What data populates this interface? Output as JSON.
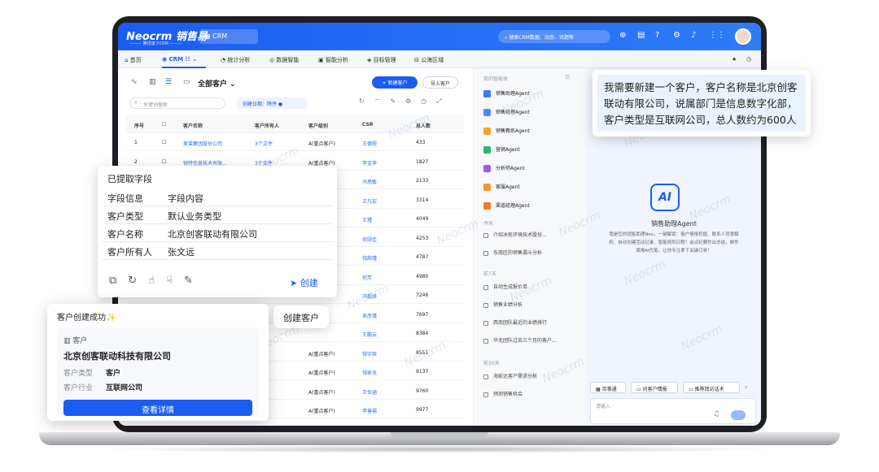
{
  "topbar": {
    "logo": "Neocrm 销售易",
    "logo_sub": "——— 腾讯旗下CRM ———",
    "app_selector": "CRM",
    "search_placeholder": "搜索CRM数据、动态、讯题等"
  },
  "nav": {
    "items": [
      {
        "label": "首页"
      },
      {
        "label": "CRM"
      },
      {
        "label": "统计分析"
      },
      {
        "label": "数据智能"
      },
      {
        "label": "智能分析"
      },
      {
        "label": "目标管理"
      },
      {
        "label": "公海区域"
      }
    ]
  },
  "list": {
    "view_label": "全部客户",
    "new_button": "+ 新建客户",
    "import_button": "导入客户",
    "search_placeholder": "关键词搜索",
    "sort_chip": "创建日期：降序",
    "headers": [
      "序号",
      "客户名称",
      "客户所有人",
      "客户级别",
      "CSR",
      "总人数"
    ],
    "rows": [
      {
        "n": "1",
        "name": "美莱集团股份公司",
        "owner": "3个文件",
        "level": "A(重点客户)",
        "csr": "王德程",
        "total": "433"
      },
      {
        "n": "2",
        "name": "锐特信息技术有限...",
        "owner": "3个文件",
        "level": "A(重点客户)",
        "csr": "李金萍",
        "total": "1827"
      },
      {
        "n": "",
        "name": "",
        "owner": "",
        "level": "",
        "csr": "冯思敏",
        "total": "2133"
      },
      {
        "n": "",
        "name": "",
        "owner": "",
        "level": "",
        "csr": "王凡宏",
        "total": "3314"
      },
      {
        "n": "",
        "name": "",
        "owner": "",
        "level": "",
        "csr": "王瑾",
        "total": "4049"
      },
      {
        "n": "",
        "name": "",
        "owner": "",
        "level": "",
        "csr": "何翊佳",
        "total": "4253"
      },
      {
        "n": "",
        "name": "",
        "owner": "",
        "level": "",
        "csr": "钱韵瑾",
        "total": "4787"
      },
      {
        "n": "",
        "name": "",
        "owner": "",
        "level": "",
        "csr": "何芳",
        "total": "4980"
      },
      {
        "n": "",
        "name": "",
        "owner": "",
        "level": "",
        "csr": "冯毅妍",
        "total": "7246"
      },
      {
        "n": "",
        "name": "",
        "owner": "",
        "level": "",
        "csr": "吴彦瑾",
        "total": "7697"
      },
      {
        "n": "",
        "name": "",
        "owner": "",
        "level": "",
        "csr": "王鹏云",
        "total": "8384"
      },
      {
        "n": "",
        "name": "",
        "owner": "",
        "level": "A(重点客户)",
        "csr": "钱宇辰",
        "total": "8551"
      },
      {
        "n": "",
        "name": "",
        "owner": "",
        "level": "A(重点客户)",
        "csr": "钱家龙",
        "total": "9137"
      },
      {
        "n": "",
        "name": "",
        "owner": "",
        "level": "A(重点客户)",
        "csr": "王怡涵",
        "total": "9760"
      },
      {
        "n": "",
        "name": "",
        "owner": "",
        "level": "A(重点客户)",
        "csr": "李善福",
        "total": "9977"
      }
    ]
  },
  "assistant": {
    "title": "我的智能体",
    "agents": [
      "销售助理Agent",
      "销售经理Agent",
      "销售教练Agent",
      "营销Agent",
      "分析师Agent",
      "客服Agent",
      "渠道经理Agent"
    ],
    "agent_colors": [
      "#3b7cf5",
      "#4c8af7",
      "#f5a524",
      "#2fb36f",
      "#9b5cf2",
      "#f59524",
      "#f07a2a"
    ],
    "today_label": "今天",
    "today": [
      "介绍冰轮环境技术股份...",
      "东南区的销售漏斗分析"
    ],
    "week_label": "前7天",
    "week": [
      "自动生成报价单",
      "销售业绩分析",
      "西南团队最近的业绩排行",
      "华北团队过去三个月的客户..."
    ],
    "month_label": "前30天",
    "month": [
      "海能达客户需求分析",
      "预测销售机会"
    ]
  },
  "welcome": {
    "title": "销售助理Agent",
    "description": "我是您的销售助理Neo，一键解锁：客户情报挖掘、联系人背景解析、自动创建活动记录、智能规划日程！会议纪要秒出总结，邮件周报AI代笔，让你专注拿下关键订单！",
    "quick": [
      "百事通",
      "问客户情报",
      "推荐拜访话术"
    ],
    "input_placeholder": "请输入"
  },
  "bubble": {
    "text": "我需要新建一个客户，客户名称是北京创客联动有限公司，说属部门是信息数字化部，客户类型是互联网公司，总人数约为600人"
  },
  "fields_card": {
    "title": "已提取字段",
    "col1": "字段信息",
    "col2": "字段内容",
    "rows": [
      {
        "k": "客户类型",
        "v": "默认业务类型"
      },
      {
        "k": "客户名称",
        "v": "北京创客联动有限公司"
      },
      {
        "k": "客户所有人",
        "v": "张文远"
      }
    ],
    "create": "创建"
  },
  "create_customer_button": "创建客户",
  "success_card": {
    "title": "客户创建成功",
    "entity": "客户",
    "name": "北京创客联动科技有限公司",
    "type_label": "客户类型",
    "type_value": "客户",
    "industry_label": "客户行业",
    "industry_value": "互联网公司",
    "view_button": "查看详情"
  },
  "watermark": "Neocrm"
}
